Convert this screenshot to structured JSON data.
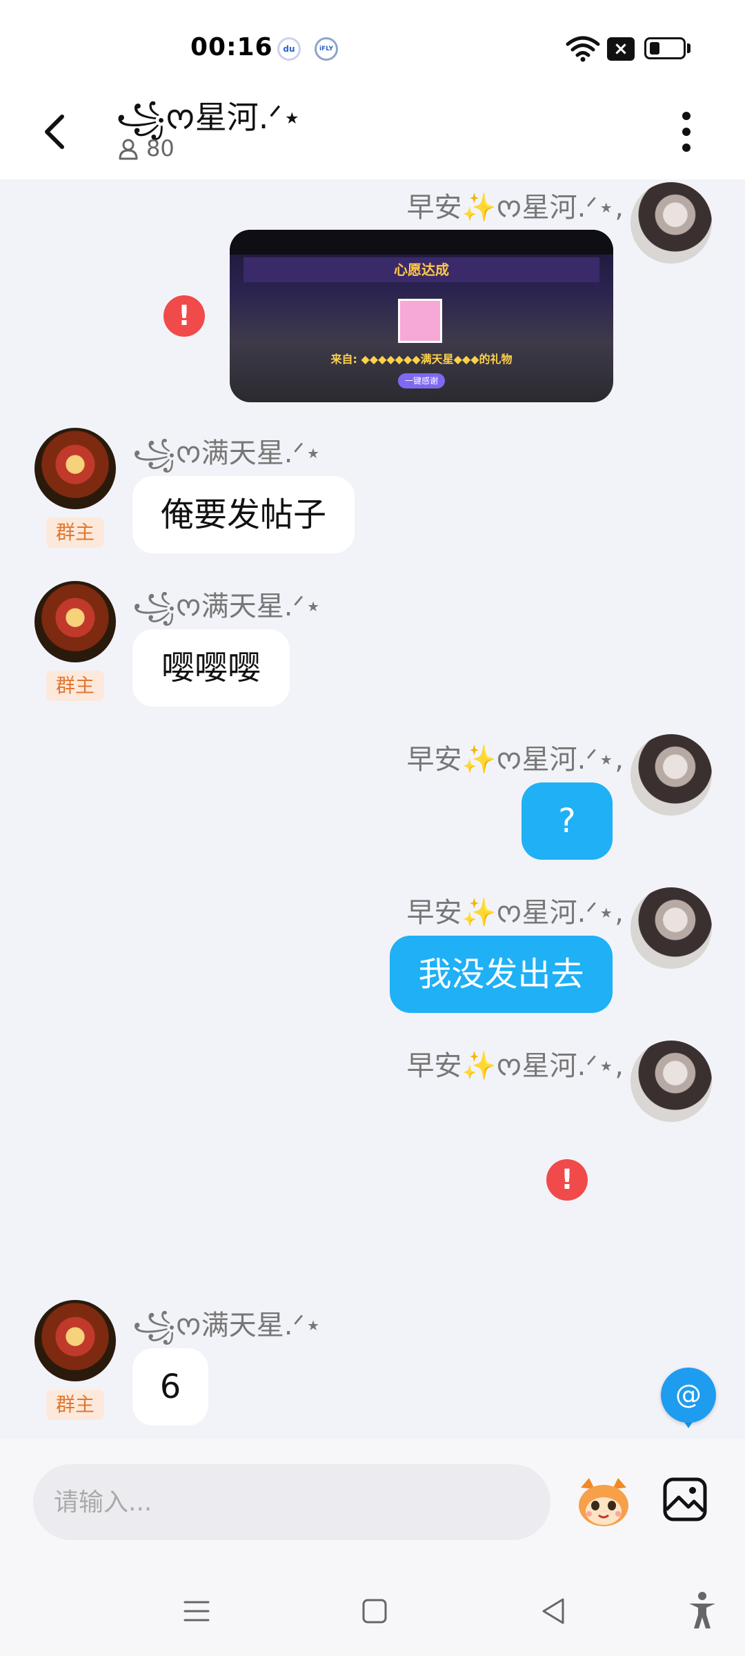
{
  "status_bar": {
    "time": "00:16",
    "notification_icons": [
      "baidu-icon",
      "ifly-icon"
    ],
    "baidu_label": "du",
    "ifly_label": "iFLY"
  },
  "header": {
    "title": "꧁ᰔ星河.ᐟ⋆",
    "member_count": "80"
  },
  "messages": [
    {
      "side": "right",
      "sender": "早安✨ᰔ星河.ᐟ⋆,",
      "type": "image",
      "failed": true,
      "image": {
        "banner": "心愿达成",
        "from_text": "来自: ◆◆◆◆◆◆◆满天星◆◆◆的礼物",
        "button": "一键感谢"
      }
    },
    {
      "side": "left",
      "sender": "꧁ᰔ满天星.ᐟ⋆",
      "badge": "群主",
      "text": "俺要发帖子"
    },
    {
      "side": "left",
      "sender": "꧁ᰔ满天星.ᐟ⋆",
      "badge": "群主",
      "text": "嘤嘤嘤"
    },
    {
      "side": "right",
      "sender": "早安✨ᰔ星河.ᐟ⋆,",
      "text": "?"
    },
    {
      "side": "right",
      "sender": "早安✨ᰔ星河.ᐟ⋆,",
      "text": "我没发出去"
    },
    {
      "side": "right",
      "sender": "早安✨ᰔ星河.ᐟ⋆,",
      "type": "failed",
      "failed": true
    },
    {
      "side": "left",
      "sender": "꧁ᰔ满天星.ᐟ⋆",
      "badge": "群主",
      "text": "6"
    }
  ],
  "input": {
    "placeholder": "请输入..."
  },
  "mention_button": "@",
  "error_glyph": "!",
  "colors": {
    "accent_blue": "#1fb0f6",
    "error_red": "#f04a4a",
    "owner_badge_text": "#e3762d",
    "owner_badge_bg": "#fde9dc"
  }
}
